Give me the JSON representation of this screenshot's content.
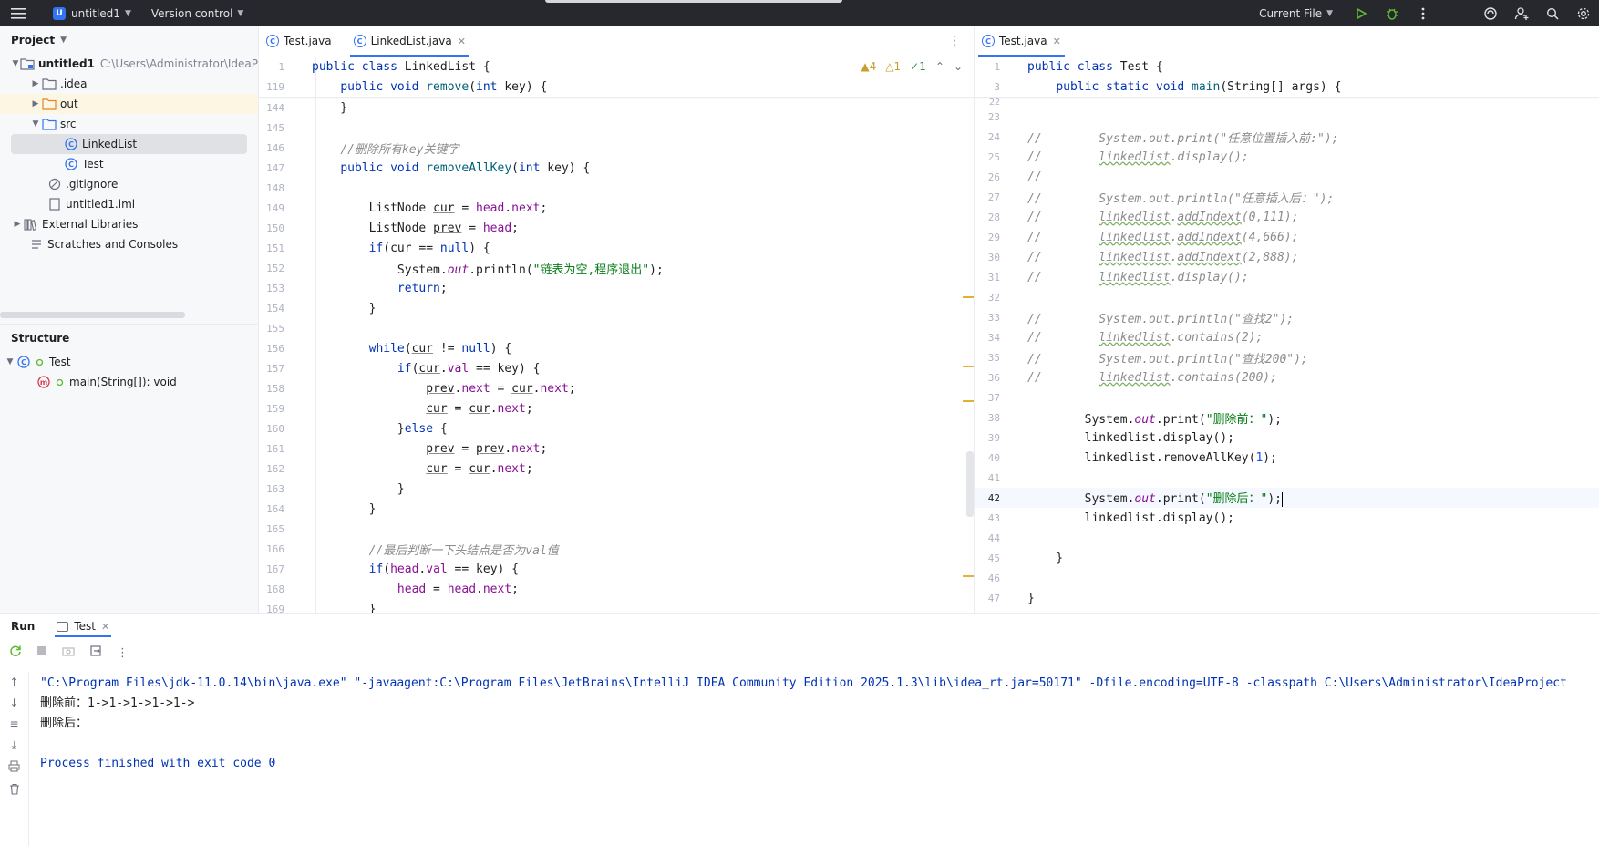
{
  "titlebar": {
    "project_badge": "U",
    "project_name": "untitled1",
    "vcs_label": "Version control",
    "run_config": "Current File"
  },
  "project_panel": {
    "title": "Project",
    "items": [
      {
        "label": "untitled1",
        "hint": "C:\\Users\\Administrator\\IdeaP"
      },
      {
        "label": ".idea"
      },
      {
        "label": "out"
      },
      {
        "label": "src"
      },
      {
        "label": "LinkedList"
      },
      {
        "label": "Test"
      },
      {
        "label": ".gitignore"
      },
      {
        "label": "untitled1.iml"
      },
      {
        "label": "External Libraries"
      },
      {
        "label": "Scratches and Consoles"
      }
    ]
  },
  "structure_panel": {
    "title": "Structure",
    "items": [
      {
        "label": "Test"
      },
      {
        "label": "main(String[]): void"
      }
    ]
  },
  "left_editor": {
    "tabs": [
      {
        "label": "Test.java"
      },
      {
        "label": "LinkedList.java"
      }
    ],
    "inspections": {
      "warnings": "4",
      "weak_warnings": "1",
      "ok": "1"
    }
  },
  "right_editor": {
    "tabs": [
      {
        "label": "Test.java"
      }
    ]
  },
  "run_panel": {
    "title": "Run",
    "tab_label": "Test",
    "console": [
      "\"C:\\Program Files\\jdk-11.0.14\\bin\\java.exe\" \"-javaagent:C:\\Program Files\\JetBrains\\IntelliJ IDEA Community Edition 2025.1.3\\lib\\idea_rt.jar=50171\" -Dfile.encoding=UTF-8 -classpath C:\\Users\\Administrator\\IdeaProject",
      "删除前：1->1->1->1->1->",
      "删除后：",
      "",
      "Process finished with exit code 0"
    ]
  },
  "colors": {
    "accent": "#3574f0",
    "keyword": "#0033b3",
    "string": "#067d17",
    "field": "#871094",
    "number": "#1750eb",
    "comment": "#8c8c8c",
    "titlebar_bg": "#27282e",
    "run_green": "#5fb832"
  },
  "icons": [
    "hamburger-menu-icon",
    "chevron-down-icon",
    "run-icon",
    "debug-icon",
    "more-vertical-icon",
    "ai-assistant-icon",
    "add-user-icon",
    "search-icon",
    "settings-icon",
    "folder-icon",
    "class-icon",
    "rerun-icon",
    "stop-icon",
    "camera-icon",
    "exit-icon",
    "up-arrow-icon",
    "down-arrow-icon",
    "soft-wrap-icon",
    "scroll-end-icon",
    "print-icon",
    "trash-icon"
  ]
}
